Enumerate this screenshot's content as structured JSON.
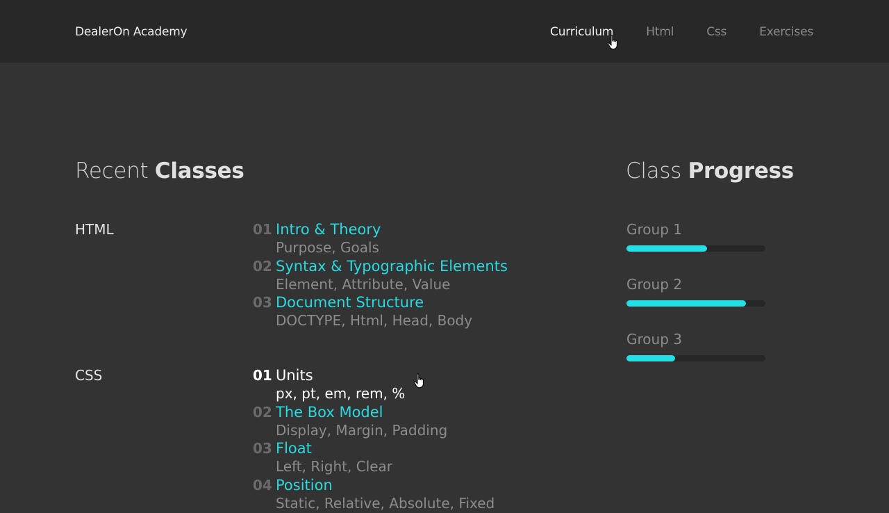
{
  "header": {
    "brand": "DealerOn Academy",
    "nav": [
      {
        "label": "Curriculum",
        "active": true
      },
      {
        "label": "Html",
        "active": false
      },
      {
        "label": "Css",
        "active": false
      },
      {
        "label": "Exercises",
        "active": false
      }
    ]
  },
  "recent": {
    "title_light": "Recent ",
    "title_bold": "Classes",
    "groups": [
      {
        "name": "HTML",
        "lessons": [
          {
            "num": "01",
            "title": "Intro & Theory",
            "sub": "Purpose, Goals"
          },
          {
            "num": "02",
            "title": "Syntax & Typographic Elements",
            "sub": "Element, Attribute, Value"
          },
          {
            "num": "03",
            "title": "Document Structure",
            "sub": "DOCTYPE, Html, Head, Body"
          }
        ]
      },
      {
        "name": "CSS",
        "lessons": [
          {
            "num": "01",
            "title": "Units",
            "sub": "px, pt, em, rem, %",
            "active": true
          },
          {
            "num": "02",
            "title": "The Box Model",
            "sub": "Display, Margin, Padding"
          },
          {
            "num": "03",
            "title": "Float",
            "sub": "Left, Right, Clear"
          },
          {
            "num": "04",
            "title": "Position",
            "sub": "Static, Relative, Absolute, Fixed"
          }
        ]
      }
    ]
  },
  "progress": {
    "title_light": "Class ",
    "title_bold": "Progress",
    "groups": [
      {
        "label": "Group 1",
        "percent": 58
      },
      {
        "label": "Group 2",
        "percent": 86
      },
      {
        "label": "Group 3",
        "percent": 35
      }
    ]
  },
  "colors": {
    "accent": "#24e0e6",
    "background": "#333333",
    "header_bg": "#282828"
  },
  "icons": {
    "cursor": "hand-pointer-icon"
  }
}
